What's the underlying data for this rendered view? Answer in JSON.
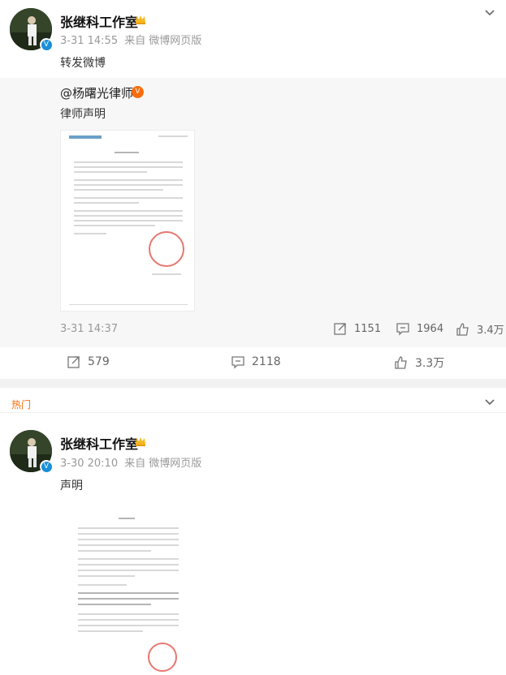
{
  "post1": {
    "username": "张继科工作室",
    "time": "3-31 14:55",
    "source_prefix": "来自",
    "source": "微博网页版",
    "text": "转发微博",
    "repost": {
      "author": "@杨曙光律师",
      "badge": "V",
      "text": "律师声明",
      "time": "3-31 14:37",
      "reposts": "1151",
      "comments": "1964",
      "likes": "3.4万"
    },
    "actions": {
      "reposts": "579",
      "comments": "2118",
      "likes": "3.3万"
    }
  },
  "post2": {
    "hot_label": "热门",
    "username": "张继科工作室",
    "time": "3-30 20:10",
    "source_prefix": "来自",
    "source": "微博网页版",
    "text": "声明"
  },
  "verified_badge": "V",
  "colors": {
    "accent_orange": "#f96c0a",
    "verified_blue": "#1a8ed9",
    "meta_gray": "#999999",
    "seal_red": "#e8776f"
  },
  "icons": [
    "chevron-down-icon",
    "crown-icon",
    "repost-icon",
    "comment-icon",
    "like-icon"
  ]
}
